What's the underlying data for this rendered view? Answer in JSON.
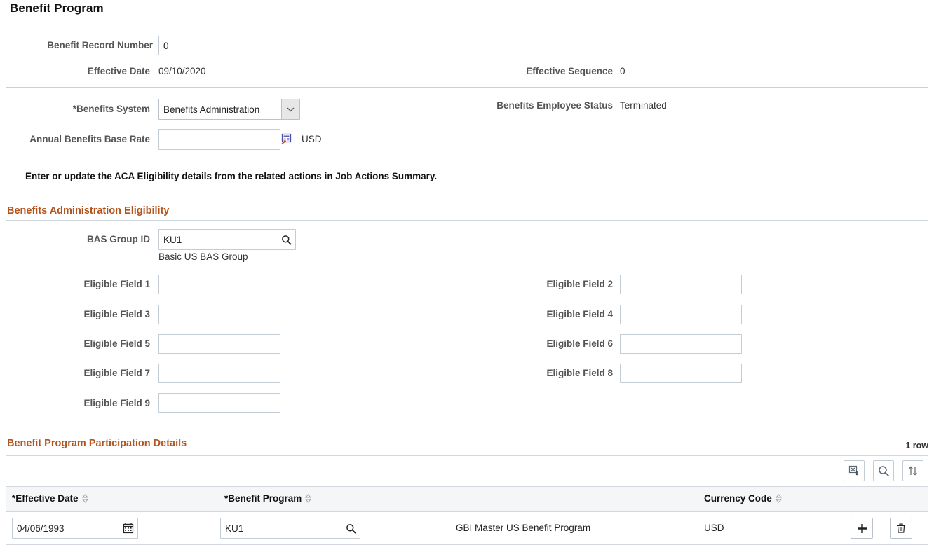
{
  "page": {
    "title": "Benefit Program"
  },
  "header": {
    "benefit_record_number_label": "Benefit Record Number",
    "benefit_record_number_value": "0",
    "effective_date_label": "Effective Date",
    "effective_date_value": "09/10/2020",
    "effective_sequence_label": "Effective Sequence",
    "effective_sequence_value": "0"
  },
  "system": {
    "benefits_system_label": "*Benefits System",
    "benefits_system_value": "Benefits Administration",
    "benefits_system_options": [
      "Benefits Administration"
    ],
    "benefits_employee_status_label": "Benefits Employee Status",
    "benefits_employee_status_value": "Terminated",
    "annual_base_rate_label": "Annual Benefits Base Rate",
    "annual_base_rate_value": "",
    "annual_base_rate_currency": "USD"
  },
  "note": {
    "aca_message": "Enter or update the ACA Eligibility details from the related actions in Job Actions Summary."
  },
  "eligibility": {
    "section_title": "Benefits Administration Eligibility",
    "bas_group_id_label": "BAS Group ID",
    "bas_group_id_value": "KU1",
    "bas_group_id_description": "Basic US BAS Group",
    "fields": [
      {
        "label": "Eligible Field 1",
        "value": ""
      },
      {
        "label": "Eligible Field 2",
        "value": ""
      },
      {
        "label": "Eligible Field 3",
        "value": ""
      },
      {
        "label": "Eligible Field 4",
        "value": ""
      },
      {
        "label": "Eligible Field 5",
        "value": ""
      },
      {
        "label": "Eligible Field 6",
        "value": ""
      },
      {
        "label": "Eligible Field 7",
        "value": ""
      },
      {
        "label": "Eligible Field 8",
        "value": ""
      },
      {
        "label": "Eligible Field 9",
        "value": ""
      }
    ]
  },
  "participation": {
    "section_title": "Benefit Program Participation Details",
    "row_count_label": "1 row",
    "toolbar": {
      "download_icon": "download-to-excel-icon",
      "find_icon": "search-icon",
      "sort_icon": "sort-updown-icon"
    },
    "columns": [
      {
        "label": "*Effective Date",
        "sortable": true
      },
      {
        "label": "*Benefit Program",
        "sortable": true
      },
      {
        "label": "",
        "sortable": false
      },
      {
        "label": "Currency Code",
        "sortable": true
      }
    ],
    "rows": [
      {
        "effective_date": "04/06/1993",
        "benefit_program": "KU1",
        "benefit_program_description": "GBI Master US Benefit Program",
        "currency_code": "USD",
        "add_icon": "plus-icon",
        "delete_icon": "trash-icon"
      }
    ]
  },
  "colors": {
    "section_header": "#b3541e",
    "label_text": "#555555",
    "field_border": "#c3ccd4",
    "grid_header_bg": "#f5f6f7"
  }
}
